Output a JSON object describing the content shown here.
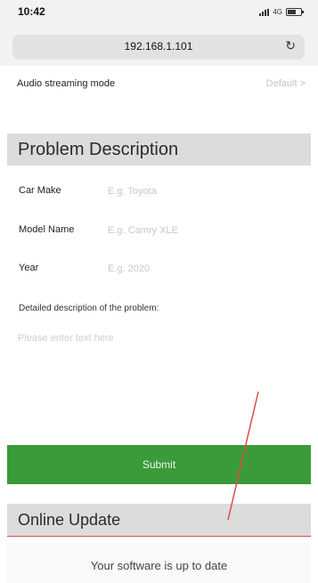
{
  "status_bar": {
    "time": "10:42",
    "network": "4G"
  },
  "browser": {
    "url": "192.168.1.101",
    "reload_icon": "reload-icon"
  },
  "settings": {
    "audio_streaming_label": "Audio streaming mode",
    "audio_streaming_value": "Default >"
  },
  "problem": {
    "title": "Problem Description",
    "car_make_label": "Car Make",
    "car_make_placeholder": "E.g. Toyota",
    "model_name_label": "Model Name",
    "model_name_placeholder": "E.g. Camry XLE",
    "year_label": "Year",
    "year_placeholder": "E.g. 2020",
    "description_label": "Detailed description of the problem:",
    "description_placeholder": "Please enter text here",
    "submit_label": "Submit"
  },
  "update": {
    "title": "Online Update",
    "status_text": "Your software is up to date"
  },
  "colors": {
    "submit_bg": "#3b9a3a",
    "section_header_bg": "#dcdcdc",
    "annotation_line": "#e04a4a"
  }
}
